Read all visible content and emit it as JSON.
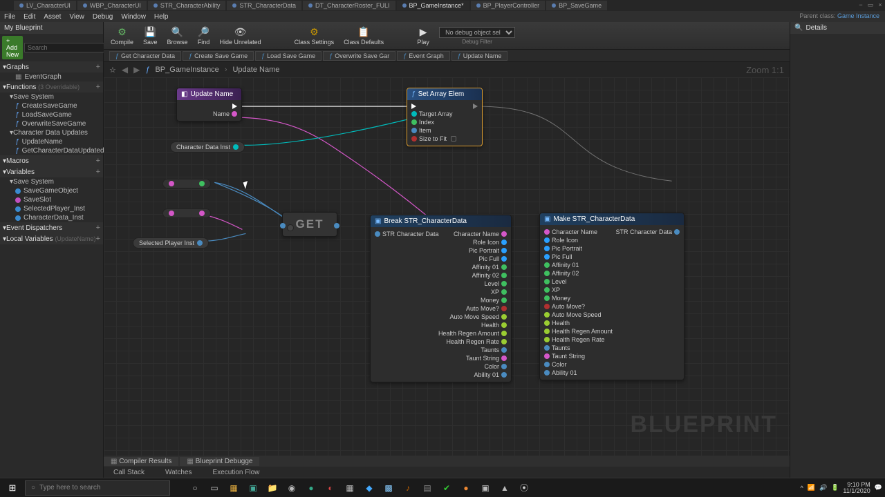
{
  "fileTabs": [
    {
      "label": "LV_CharacterUI"
    },
    {
      "label": "WBP_CharacterUI"
    },
    {
      "label": "STR_CharacterAbility"
    },
    {
      "label": "STR_CharacterData"
    },
    {
      "label": "DT_CharacterRoster_FULI"
    },
    {
      "label": "BP_GameInstance*",
      "active": true
    },
    {
      "label": "BP_PlayerController"
    },
    {
      "label": "BP_SaveGame"
    }
  ],
  "menu": [
    "File",
    "Edit",
    "Asset",
    "View",
    "Debug",
    "Window",
    "Help"
  ],
  "parentClass": {
    "label": "Parent class:",
    "value": "Game Instance"
  },
  "sidebar": {
    "title": "My Blueprint",
    "addNew": "+ Add New",
    "searchPlaceholder": "Search",
    "sections": {
      "graphs": {
        "label": "Graphs",
        "items": [
          "EventGraph"
        ]
      },
      "functions": {
        "label": "Functions",
        "note": "(3 Overridable)"
      },
      "saveSystem1": {
        "label": "Save System",
        "items": [
          "CreateSaveGame",
          "LoadSaveGame",
          "OverwriteSaveGame"
        ]
      },
      "charUpdates": {
        "label": "Character Data Updates",
        "items": [
          "UpdateName",
          "GetCharacterDataUpdated"
        ]
      },
      "macros": {
        "label": "Macros"
      },
      "variables": {
        "label": "Variables"
      },
      "saveSystem2": {
        "label": "Save System",
        "items": [
          {
            "label": "SaveGameObject",
            "color": "#3a8bd0"
          },
          {
            "label": "SaveSlot",
            "color": "#c050c0"
          },
          {
            "label": "SelectedPlayer_Inst",
            "color": "#3a8bd0"
          },
          {
            "label": "CharacterData_Inst",
            "color": "#3a8bd0"
          }
        ]
      },
      "dispatchers": {
        "label": "Event Dispatchers"
      },
      "localVars": {
        "label": "Local Variables",
        "note": "(UpdateName)"
      }
    }
  },
  "toolbar": {
    "compile": "Compile",
    "save": "Save",
    "browse": "Browse",
    "find": "Find",
    "hideUnrelated": "Hide Unrelated",
    "classSettings": "Class Settings",
    "classDefaults": "Class Defaults",
    "play": "Play",
    "debugObject": "No debug object selected",
    "debugFilter": "Debug Filter"
  },
  "fnTabs": [
    "Get Character Data",
    "Create Save Game",
    "Load Save Game",
    "Overwrite Save Gar",
    "Event Graph",
    "Update Name"
  ],
  "breadcrumb": {
    "root": "BP_GameInstance",
    "leaf": "Update Name",
    "zoom": "Zoom 1:1"
  },
  "nodes": {
    "updateName": {
      "title": "Update Name",
      "pins": {
        "name": "Name"
      }
    },
    "setArrayElem": {
      "title": "Set Array Elem",
      "pins": [
        "Target Array",
        "Index",
        "Item",
        "Size to Fit"
      ]
    },
    "charDataInst": "Character Data Inst",
    "selectedPlayerInst": "Selected Player Inst",
    "get": "GET",
    "breakStruct": {
      "title": "Break STR_CharacterData",
      "input": "STR Character Data",
      "outputs": [
        "Character Name",
        "Role Icon",
        "Pic Portrait",
        "Pic Full",
        "Affinity 01",
        "Affinity 02",
        "Level",
        "XP",
        "Money",
        "Auto Move?",
        "Auto Move Speed",
        "Health",
        "Health Regen Amount",
        "Health Regen Rate",
        "Taunts",
        "Taunt String",
        "Color",
        "Ability 01"
      ]
    },
    "makeStruct": {
      "title": "Make STR_CharacterData",
      "output": "STR Character Data",
      "inputs": [
        "Character Name",
        "Role Icon",
        "Pic Portrait",
        "Pic Full",
        "Affinity 01",
        "Affinity 02",
        "Level",
        "XP",
        "Money",
        "Auto Move?",
        "Auto Move Speed",
        "Health",
        "Health Regen Amount",
        "Health Regen Rate",
        "Taunts",
        "Taunt String",
        "Color",
        "Ability 01"
      ]
    }
  },
  "pinColors": {
    "CharacterName": "#d457c8",
    "RoleIcon": "#2aa0ff",
    "PicPortrait": "#2aa0ff",
    "PicFull": "#2aa0ff",
    "Affinity01": "#3fc060",
    "Affinity02": "#3fc060",
    "Level": "#3fc060",
    "XP": "#3fc060",
    "Money": "#3fc060",
    "AutoMove": "#b03030",
    "AutoMoveSpeed": "#9acd32",
    "Health": "#9acd32",
    "HealthRegenAmount": "#9acd32",
    "HealthRegenRate": "#9acd32",
    "Taunts": "#4a8bc0",
    "TauntString": "#d457c8",
    "Color": "#4a8bc0",
    "Ability01": "#4a8bc0"
  },
  "details": {
    "title": "Details"
  },
  "bottomTabs": [
    "Compiler Results",
    "Blueprint Debugge"
  ],
  "bottomRow": [
    "Call Stack",
    "Watches",
    "Execution Flow"
  ],
  "watermark": "BLUEPRINT",
  "taskbar": {
    "search": "Type here to search",
    "time": "9:10 PM",
    "date": "11/1/2020"
  }
}
